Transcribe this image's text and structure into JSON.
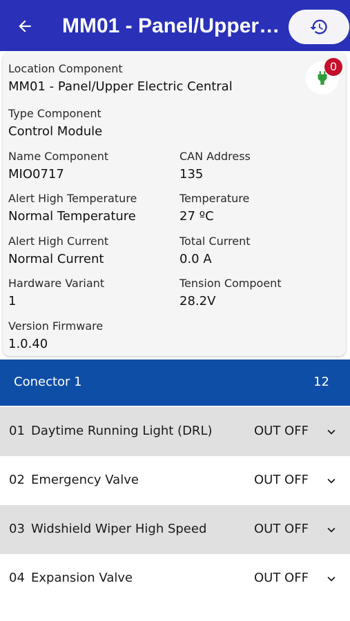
{
  "appbar": {
    "title": "MM01 - Panel/Upper Electric Central",
    "back_icon": "arrow-left-icon",
    "history_icon": "history-icon"
  },
  "card": {
    "location_label": "Location Component",
    "location_value": "MM01 - Panel/Upper Electric Central",
    "type_label": "Type Component",
    "type_value": "Control Module",
    "name_label": "Name Component",
    "name_value": "MIO0717",
    "can_label": "CAN Address",
    "can_value": "135",
    "alert_temp_label": "Alert High Temperature",
    "alert_temp_value": "Normal Temperature",
    "temp_label": "Temperature",
    "temp_value": "27 ºC",
    "alert_current_label": "Alert High Current",
    "alert_current_value": "Normal Current",
    "total_current_label": "Total Current",
    "total_current_value": "0.0 A",
    "hw_label": "Hardware Variant",
    "hw_value": "1",
    "tension_label": "Tension Compoent",
    "tension_value": "28.2V",
    "fw_label": "Version Firmware",
    "fw_value": "1.0.40",
    "plug_badge": "0",
    "plug_color": "#2e9e3a",
    "badge_color": "#c4102a"
  },
  "connector": {
    "name": "Conector 1",
    "count": "12"
  },
  "rows": [
    {
      "num": "01",
      "name": "Daytime Running Light (DRL)",
      "status": "OUT OFF"
    },
    {
      "num": "02",
      "name": "Emergency Valve",
      "status": "OUT OFF"
    },
    {
      "num": "03",
      "name": "Widshield Wiper High Speed",
      "status": "OUT OFF"
    },
    {
      "num": "04",
      "name": "Expansion Valve",
      "status": "OUT OFF"
    }
  ],
  "colors": {
    "appbar": "#2a31b8",
    "connector": "#0f4ea6",
    "row_shade": "#e0e0e0"
  }
}
